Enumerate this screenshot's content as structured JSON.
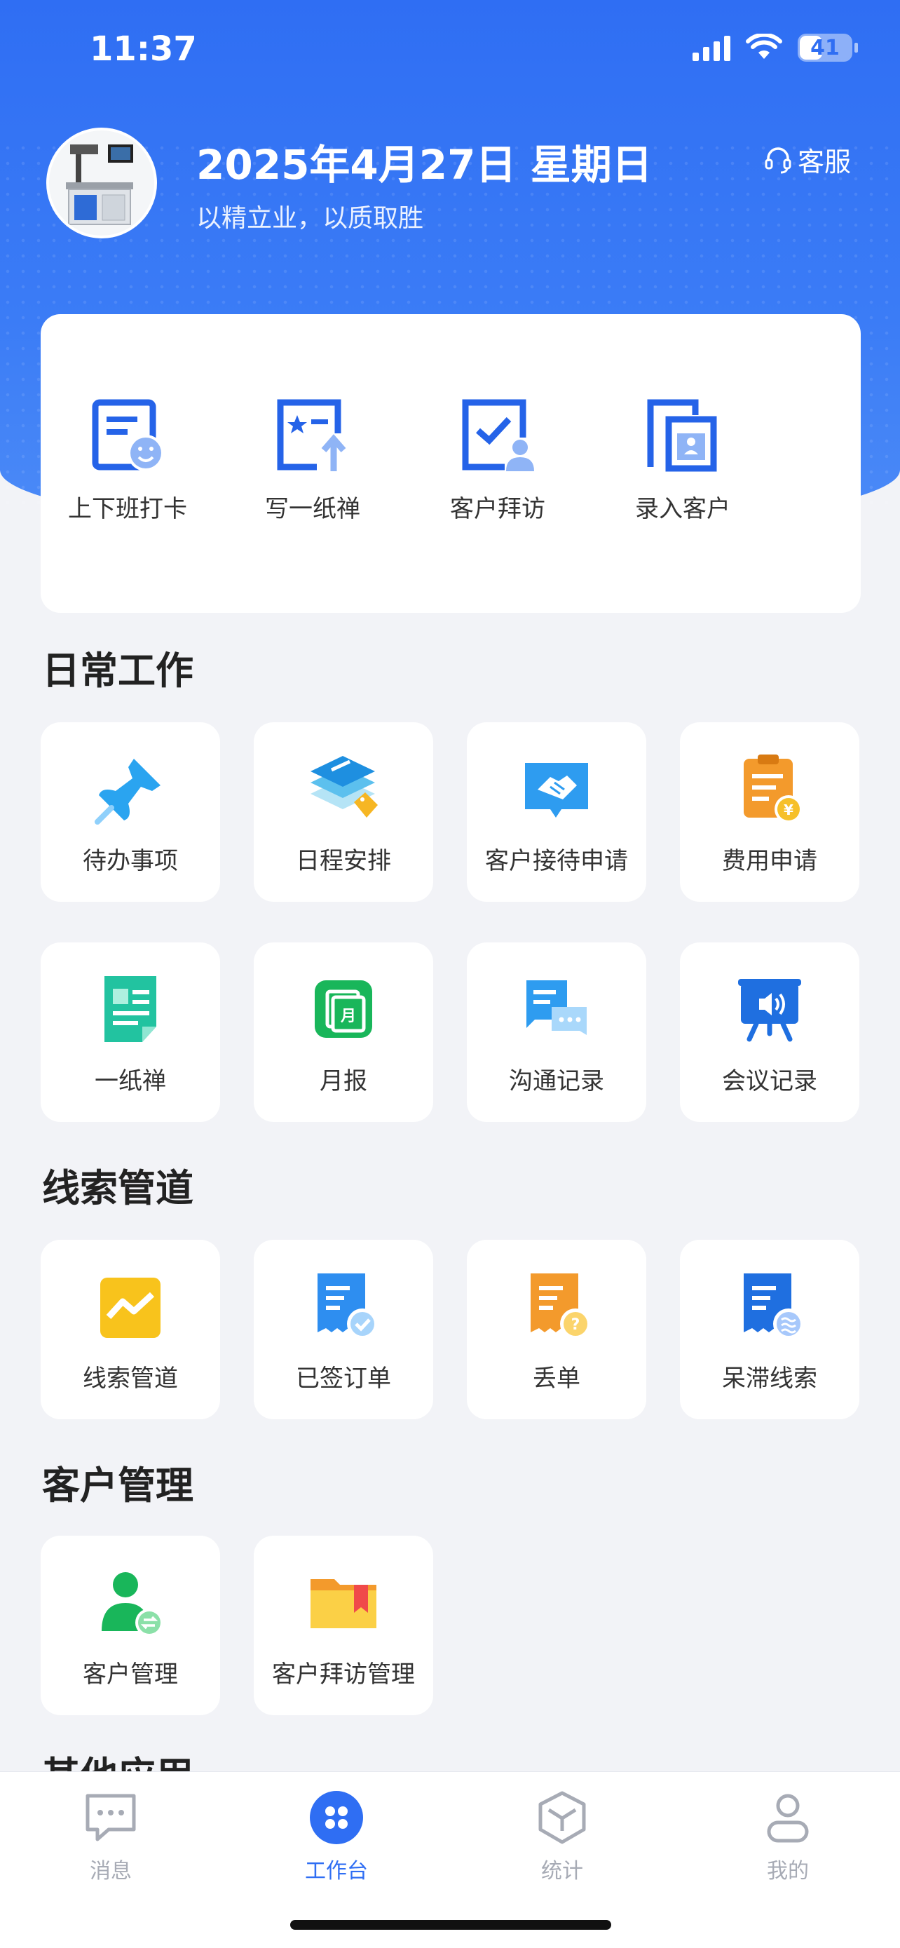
{
  "status": {
    "time": "11:37",
    "battery": "41"
  },
  "header": {
    "date": "2025年4月27日 星期日",
    "slogan": "以精立业，以质取胜",
    "service_label": "客服"
  },
  "quick_actions": [
    {
      "label": "上下班打卡",
      "icon": "checkin-icon"
    },
    {
      "label": "写一纸禅",
      "icon": "write-note-icon"
    },
    {
      "label": "客户拜访",
      "icon": "customer-visit-icon"
    },
    {
      "label": "录入客户",
      "icon": "add-customer-icon"
    }
  ],
  "sections": {
    "daily_work": {
      "title": "日常工作",
      "items": [
        {
          "label": "待办事项",
          "icon": "pin-icon"
        },
        {
          "label": "日程安排",
          "icon": "schedule-icon"
        },
        {
          "label": "客户接待申请",
          "icon": "handshake-icon"
        },
        {
          "label": "费用申请",
          "icon": "expense-icon"
        },
        {
          "label": "一纸禅",
          "icon": "document-icon"
        },
        {
          "label": "月报",
          "icon": "monthly-report-icon"
        },
        {
          "label": "沟通记录",
          "icon": "chat-record-icon"
        },
        {
          "label": "会议记录",
          "icon": "meeting-icon"
        }
      ]
    },
    "leads": {
      "title": "线索管道",
      "items": [
        {
          "label": "线索管道",
          "icon": "trend-icon"
        },
        {
          "label": "已签订单",
          "icon": "signed-order-icon"
        },
        {
          "label": "丢单",
          "icon": "lost-order-icon"
        },
        {
          "label": "呆滞线索",
          "icon": "stale-lead-icon"
        }
      ]
    },
    "customers": {
      "title": "客户管理",
      "items": [
        {
          "label": "客户管理",
          "icon": "customer-manage-icon"
        },
        {
          "label": "客户拜访管理",
          "icon": "visit-folder-icon"
        }
      ]
    },
    "others": {
      "title": "其他应用"
    }
  },
  "tabbar": [
    {
      "label": "消息",
      "icon": "message-icon",
      "active": false
    },
    {
      "label": "工作台",
      "icon": "workbench-icon",
      "active": true
    },
    {
      "label": "统计",
      "icon": "statistics-icon",
      "active": false
    },
    {
      "label": "我的",
      "icon": "profile-icon",
      "active": false
    }
  ],
  "colors": {
    "brand": "#2f6ef3",
    "background": "#f2f3f7",
    "inactive": "#a7abb5"
  }
}
